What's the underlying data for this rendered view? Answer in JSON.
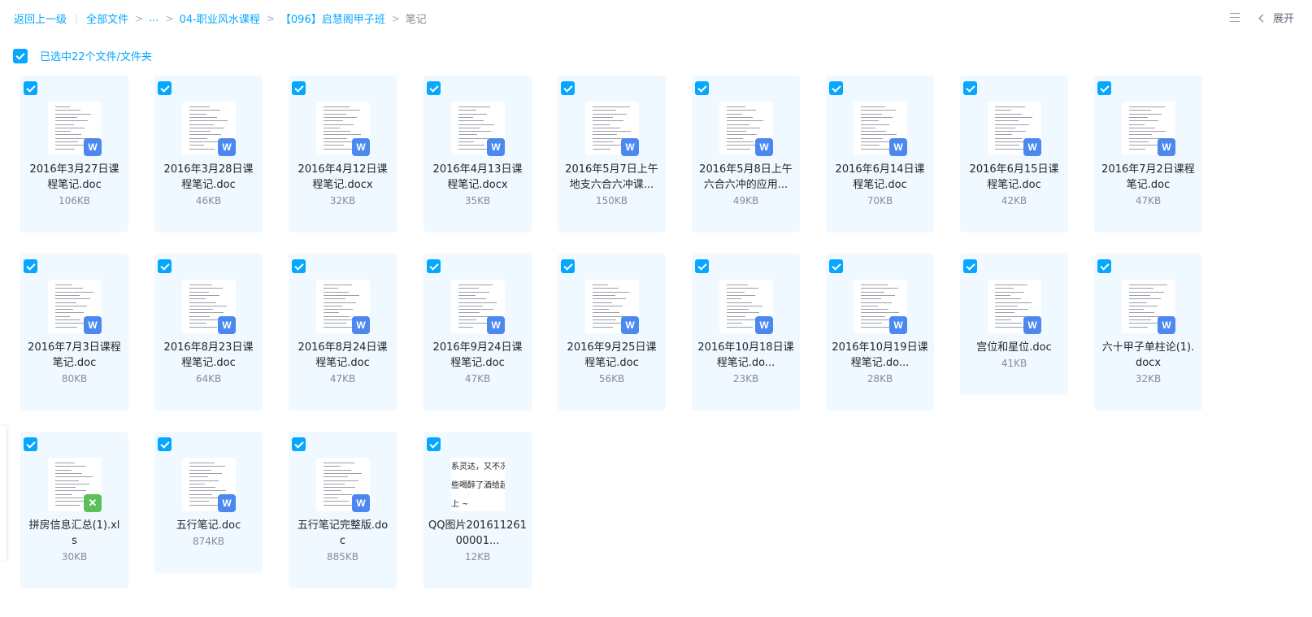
{
  "breadcrumb": {
    "back": "返回上一级",
    "items": [
      "全部文件",
      "...",
      "04-职业风水课程",
      "【096】启慧阁甲子班",
      "笔记"
    ]
  },
  "toolbar": {
    "expand_label": "展开",
    "view_icon": "list-view-icon",
    "chevron_icon": "chevron-left-icon"
  },
  "selection": {
    "label": "已选中22个文件/文件夹",
    "all_checked": true
  },
  "colors": {
    "accent": "#06a7ff",
    "card_bg": "#eff9ff",
    "word_badge": "#4c88f0",
    "excel_badge": "#5cbf5c"
  },
  "files": [
    {
      "name": "2016年3月27日课程笔记.doc",
      "display_lines": [
        "2016年3月27日课",
        "程笔记.doc"
      ],
      "size": "106KB",
      "type": "doc",
      "selected": true
    },
    {
      "name": "2016年3月28日课程笔记.doc",
      "display_lines": [
        "2016年3月28日课",
        "程笔记.doc"
      ],
      "size": "46KB",
      "type": "doc",
      "selected": true
    },
    {
      "name": "2016年4月12日课程笔记.docx",
      "display_lines": [
        "2016年4月12日课",
        "程笔记.docx"
      ],
      "size": "32KB",
      "type": "doc",
      "selected": true
    },
    {
      "name": "2016年4月13日课程笔记.docx",
      "display_lines": [
        "2016年4月13日课",
        "程笔记.docx"
      ],
      "size": "35KB",
      "type": "doc",
      "selected": true
    },
    {
      "name": "2016年5月7日上午地支六合六冲课...",
      "display_lines": [
        "2016年5月7日上午",
        "地支六合六冲课..."
      ],
      "size": "150KB",
      "type": "doc",
      "selected": true
    },
    {
      "name": "2016年5月8日上午六合六冲的应用...",
      "display_lines": [
        "2016年5月8日上午",
        "六合六冲的应用..."
      ],
      "size": "49KB",
      "type": "doc",
      "selected": true
    },
    {
      "name": "2016年6月14日课程笔记.doc",
      "display_lines": [
        "2016年6月14日课",
        "程笔记.doc"
      ],
      "size": "70KB",
      "type": "doc",
      "selected": true
    },
    {
      "name": "2016年6月15日课程笔记.doc",
      "display_lines": [
        "2016年6月15日课",
        "程笔记.doc"
      ],
      "size": "42KB",
      "type": "doc",
      "selected": true
    },
    {
      "name": "2016年7月2日课程笔记.doc",
      "display_lines": [
        "2016年7月2日课程",
        "笔记.doc"
      ],
      "size": "47KB",
      "type": "doc",
      "selected": true
    },
    {
      "name": "2016年7月3日课程笔记.doc",
      "display_lines": [
        "2016年7月3日课程",
        "笔记.doc"
      ],
      "size": "80KB",
      "type": "doc",
      "selected": true
    },
    {
      "name": "2016年8月23日课程笔记.doc",
      "display_lines": [
        "2016年8月23日课",
        "程笔记.doc"
      ],
      "size": "64KB",
      "type": "doc",
      "selected": true
    },
    {
      "name": "2016年8月24日课程笔记.doc",
      "display_lines": [
        "2016年8月24日课",
        "程笔记.doc"
      ],
      "size": "47KB",
      "type": "doc",
      "selected": true
    },
    {
      "name": "2016年9月24日课程笔记.doc",
      "display_lines": [
        "2016年9月24日课",
        "程笔记.doc"
      ],
      "size": "47KB",
      "type": "doc",
      "selected": true
    },
    {
      "name": "2016年9月25日课程笔记.doc",
      "display_lines": [
        "2016年9月25日课",
        "程笔记.doc"
      ],
      "size": "56KB",
      "type": "doc",
      "selected": true
    },
    {
      "name": "2016年10月18日课程笔记.do...",
      "display_lines": [
        "2016年10月18日课",
        "程笔记.do..."
      ],
      "size": "23KB",
      "type": "doc",
      "selected": true
    },
    {
      "name": "2016年10月19日课程笔记.do...",
      "display_lines": [
        "2016年10月19日课",
        "程笔记.do..."
      ],
      "size": "28KB",
      "type": "doc",
      "selected": true
    },
    {
      "name": "宫位和星位.doc",
      "display_lines": [
        "宫位和星位.doc"
      ],
      "size": "41KB",
      "type": "doc",
      "selected": true
    },
    {
      "name": "六十甲子单柱论(1).docx",
      "display_lines": [
        "六十甲子单柱论(1).",
        "docx"
      ],
      "size": "32KB",
      "type": "doc",
      "selected": true
    },
    {
      "name": "拼房信息汇总(1).xls",
      "display_lines": [
        "拼房信息汇总(1).xl",
        "s"
      ],
      "size": "30KB",
      "type": "xls",
      "selected": true
    },
    {
      "name": "五行笔记.doc",
      "display_lines": [
        "五行笔记.doc"
      ],
      "size": "874KB",
      "type": "doc",
      "selected": true
    },
    {
      "name": "五行笔记完整版.doc",
      "display_lines": [
        "五行笔记完整版.do",
        "c"
      ],
      "size": "885KB",
      "type": "doc",
      "selected": true
    },
    {
      "name": "QQ图片2016112600001...",
      "display_lines": [
        "QQ图片201611261",
        "00001..."
      ],
      "size": "12KB",
      "type": "image",
      "selected": true,
      "preview_text": [
        "系灵达，又不况",
        "些喝醉了酒给起",
        "上 ~"
      ]
    }
  ]
}
